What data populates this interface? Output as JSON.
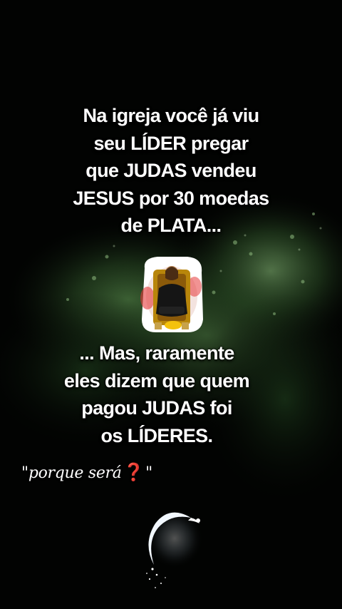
{
  "caption": {
    "top_lines": [
      "Na igreja você já viu",
      "seu LÍDER pregar",
      "que JUDAS vendeu",
      "JESUS por 30 moedas",
      "de PLATA..."
    ],
    "bottom_lines": [
      "... Mas, raramente",
      "eles dizem que quem",
      "pagou JUDAS foi",
      "os LÍDERES."
    ],
    "question_open": "\"porque será",
    "question_mark": "❓",
    "question_close": "\""
  },
  "colors": {
    "background": "#020302",
    "text": "#ffffff",
    "accent_red": "#e0141c",
    "foliage": "#2f5a2a"
  },
  "icons": {
    "sticker": "man-on-throne-sticker",
    "moon": "crescent-moon-sparkle-icon"
  }
}
